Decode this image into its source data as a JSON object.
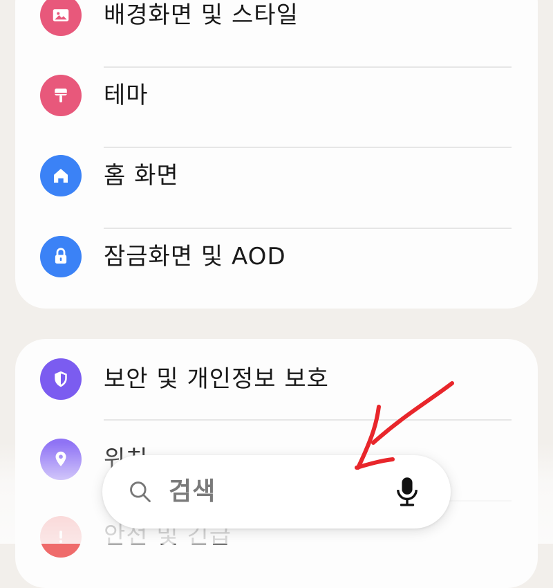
{
  "settings_group_1": {
    "items": [
      {
        "label": "배경화면 및 스타일",
        "icon": "wallpaper-image-icon",
        "icon_color": "#e8587b"
      },
      {
        "label": "테마",
        "icon": "paint-brush-icon",
        "icon_color": "#e8587b"
      },
      {
        "label": "홈 화면",
        "icon": "home-icon",
        "icon_color": "#3b82f6"
      },
      {
        "label": "잠금화면 및 AOD",
        "icon": "lock-icon",
        "icon_color": "#3b82f6"
      }
    ]
  },
  "settings_group_2": {
    "items": [
      {
        "label": "보안 및 개인정보 보호",
        "icon": "shield-icon",
        "icon_color": "#7b5cf0"
      },
      {
        "label": "위치",
        "icon": "location-pin-icon",
        "icon_color": "#8f73f5"
      },
      {
        "label": "안전 및 긴급",
        "icon": "emergency-icon",
        "icon_color": "#ef6b6b"
      }
    ]
  },
  "search": {
    "placeholder": "검색",
    "search_icon": "magnifier-icon",
    "voice_icon": "microphone-icon"
  },
  "annotation": {
    "color": "#e8262b",
    "icon": "red-hand-drawn-arrow"
  }
}
